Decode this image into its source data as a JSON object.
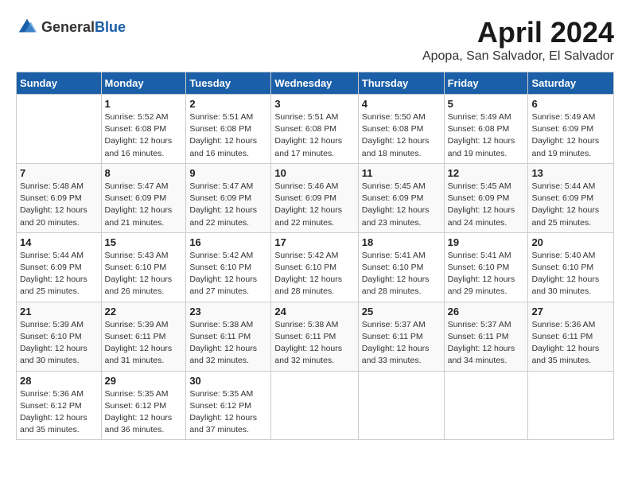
{
  "logo": {
    "general": "General",
    "blue": "Blue"
  },
  "title": "April 2024",
  "subtitle": "Apopa, San Salvador, El Salvador",
  "days_header": [
    "Sunday",
    "Monday",
    "Tuesday",
    "Wednesday",
    "Thursday",
    "Friday",
    "Saturday"
  ],
  "weeks": [
    [
      {
        "day": "",
        "sunrise": "",
        "sunset": "",
        "daylight": ""
      },
      {
        "day": "1",
        "sunrise": "Sunrise: 5:52 AM",
        "sunset": "Sunset: 6:08 PM",
        "daylight": "Daylight: 12 hours and 16 minutes."
      },
      {
        "day": "2",
        "sunrise": "Sunrise: 5:51 AM",
        "sunset": "Sunset: 6:08 PM",
        "daylight": "Daylight: 12 hours and 16 minutes."
      },
      {
        "day": "3",
        "sunrise": "Sunrise: 5:51 AM",
        "sunset": "Sunset: 6:08 PM",
        "daylight": "Daylight: 12 hours and 17 minutes."
      },
      {
        "day": "4",
        "sunrise": "Sunrise: 5:50 AM",
        "sunset": "Sunset: 6:08 PM",
        "daylight": "Daylight: 12 hours and 18 minutes."
      },
      {
        "day": "5",
        "sunrise": "Sunrise: 5:49 AM",
        "sunset": "Sunset: 6:08 PM",
        "daylight": "Daylight: 12 hours and 19 minutes."
      },
      {
        "day": "6",
        "sunrise": "Sunrise: 5:49 AM",
        "sunset": "Sunset: 6:09 PM",
        "daylight": "Daylight: 12 hours and 19 minutes."
      }
    ],
    [
      {
        "day": "7",
        "sunrise": "Sunrise: 5:48 AM",
        "sunset": "Sunset: 6:09 PM",
        "daylight": "Daylight: 12 hours and 20 minutes."
      },
      {
        "day": "8",
        "sunrise": "Sunrise: 5:47 AM",
        "sunset": "Sunset: 6:09 PM",
        "daylight": "Daylight: 12 hours and 21 minutes."
      },
      {
        "day": "9",
        "sunrise": "Sunrise: 5:47 AM",
        "sunset": "Sunset: 6:09 PM",
        "daylight": "Daylight: 12 hours and 22 minutes."
      },
      {
        "day": "10",
        "sunrise": "Sunrise: 5:46 AM",
        "sunset": "Sunset: 6:09 PM",
        "daylight": "Daylight: 12 hours and 22 minutes."
      },
      {
        "day": "11",
        "sunrise": "Sunrise: 5:45 AM",
        "sunset": "Sunset: 6:09 PM",
        "daylight": "Daylight: 12 hours and 23 minutes."
      },
      {
        "day": "12",
        "sunrise": "Sunrise: 5:45 AM",
        "sunset": "Sunset: 6:09 PM",
        "daylight": "Daylight: 12 hours and 24 minutes."
      },
      {
        "day": "13",
        "sunrise": "Sunrise: 5:44 AM",
        "sunset": "Sunset: 6:09 PM",
        "daylight": "Daylight: 12 hours and 25 minutes."
      }
    ],
    [
      {
        "day": "14",
        "sunrise": "Sunrise: 5:44 AM",
        "sunset": "Sunset: 6:09 PM",
        "daylight": "Daylight: 12 hours and 25 minutes."
      },
      {
        "day": "15",
        "sunrise": "Sunrise: 5:43 AM",
        "sunset": "Sunset: 6:10 PM",
        "daylight": "Daylight: 12 hours and 26 minutes."
      },
      {
        "day": "16",
        "sunrise": "Sunrise: 5:42 AM",
        "sunset": "Sunset: 6:10 PM",
        "daylight": "Daylight: 12 hours and 27 minutes."
      },
      {
        "day": "17",
        "sunrise": "Sunrise: 5:42 AM",
        "sunset": "Sunset: 6:10 PM",
        "daylight": "Daylight: 12 hours and 28 minutes."
      },
      {
        "day": "18",
        "sunrise": "Sunrise: 5:41 AM",
        "sunset": "Sunset: 6:10 PM",
        "daylight": "Daylight: 12 hours and 28 minutes."
      },
      {
        "day": "19",
        "sunrise": "Sunrise: 5:41 AM",
        "sunset": "Sunset: 6:10 PM",
        "daylight": "Daylight: 12 hours and 29 minutes."
      },
      {
        "day": "20",
        "sunrise": "Sunrise: 5:40 AM",
        "sunset": "Sunset: 6:10 PM",
        "daylight": "Daylight: 12 hours and 30 minutes."
      }
    ],
    [
      {
        "day": "21",
        "sunrise": "Sunrise: 5:39 AM",
        "sunset": "Sunset: 6:10 PM",
        "daylight": "Daylight: 12 hours and 30 minutes."
      },
      {
        "day": "22",
        "sunrise": "Sunrise: 5:39 AM",
        "sunset": "Sunset: 6:11 PM",
        "daylight": "Daylight: 12 hours and 31 minutes."
      },
      {
        "day": "23",
        "sunrise": "Sunrise: 5:38 AM",
        "sunset": "Sunset: 6:11 PM",
        "daylight": "Daylight: 12 hours and 32 minutes."
      },
      {
        "day": "24",
        "sunrise": "Sunrise: 5:38 AM",
        "sunset": "Sunset: 6:11 PM",
        "daylight": "Daylight: 12 hours and 32 minutes."
      },
      {
        "day": "25",
        "sunrise": "Sunrise: 5:37 AM",
        "sunset": "Sunset: 6:11 PM",
        "daylight": "Daylight: 12 hours and 33 minutes."
      },
      {
        "day": "26",
        "sunrise": "Sunrise: 5:37 AM",
        "sunset": "Sunset: 6:11 PM",
        "daylight": "Daylight: 12 hours and 34 minutes."
      },
      {
        "day": "27",
        "sunrise": "Sunrise: 5:36 AM",
        "sunset": "Sunset: 6:11 PM",
        "daylight": "Daylight: 12 hours and 35 minutes."
      }
    ],
    [
      {
        "day": "28",
        "sunrise": "Sunrise: 5:36 AM",
        "sunset": "Sunset: 6:12 PM",
        "daylight": "Daylight: 12 hours and 35 minutes."
      },
      {
        "day": "29",
        "sunrise": "Sunrise: 5:35 AM",
        "sunset": "Sunset: 6:12 PM",
        "daylight": "Daylight: 12 hours and 36 minutes."
      },
      {
        "day": "30",
        "sunrise": "Sunrise: 5:35 AM",
        "sunset": "Sunset: 6:12 PM",
        "daylight": "Daylight: 12 hours and 37 minutes."
      },
      {
        "day": "",
        "sunrise": "",
        "sunset": "",
        "daylight": ""
      },
      {
        "day": "",
        "sunrise": "",
        "sunset": "",
        "daylight": ""
      },
      {
        "day": "",
        "sunrise": "",
        "sunset": "",
        "daylight": ""
      },
      {
        "day": "",
        "sunrise": "",
        "sunset": "",
        "daylight": ""
      }
    ]
  ]
}
